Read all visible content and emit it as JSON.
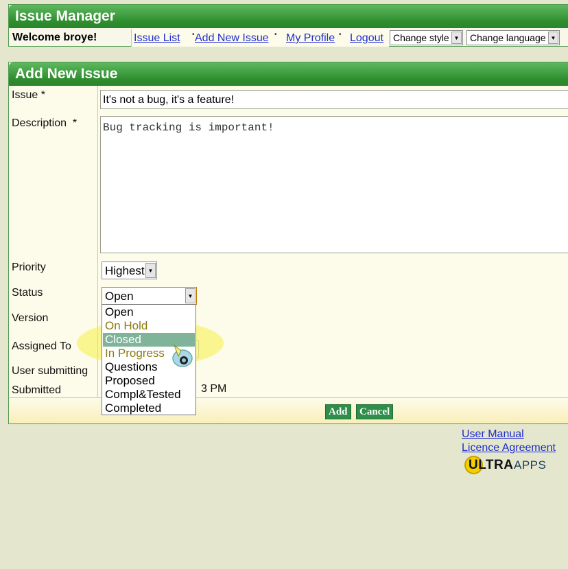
{
  "app": {
    "title": "Issue Manager",
    "welcome": "Welcome broye!",
    "nav": {
      "issue_list": "Issue List",
      "add_new_issue": "Add New Issue",
      "my_profile": "My Profile",
      "logout": "Logout"
    },
    "style_select": "Change style",
    "language_select": "Change language"
  },
  "form": {
    "title": "Add New Issue",
    "labels": {
      "issue": "Issue *",
      "description": "Description  *",
      "priority": "Priority",
      "status": "Status",
      "version": "Version",
      "assigned_to": "Assigned To",
      "user_submitting": "User submitting",
      "submitted": "Submitted"
    },
    "issue_value": "It's not a bug, it's a feature!",
    "description_value": "Bug tracking is important!",
    "priority_value": "Highest",
    "status_value": "Open",
    "submitted_fragment": "3 PM",
    "status_options": [
      "Open",
      "On Hold",
      "Closed",
      "In Progress",
      "Questions",
      "Proposed",
      "Compl&Tested",
      "Completed"
    ],
    "add_button": "Add",
    "cancel_button": "Cancel"
  },
  "footer": {
    "user_manual": "User Manual",
    "licence": "Licence Agreement",
    "logo_bold": "ULTRA",
    "logo_light": "APPS"
  }
}
